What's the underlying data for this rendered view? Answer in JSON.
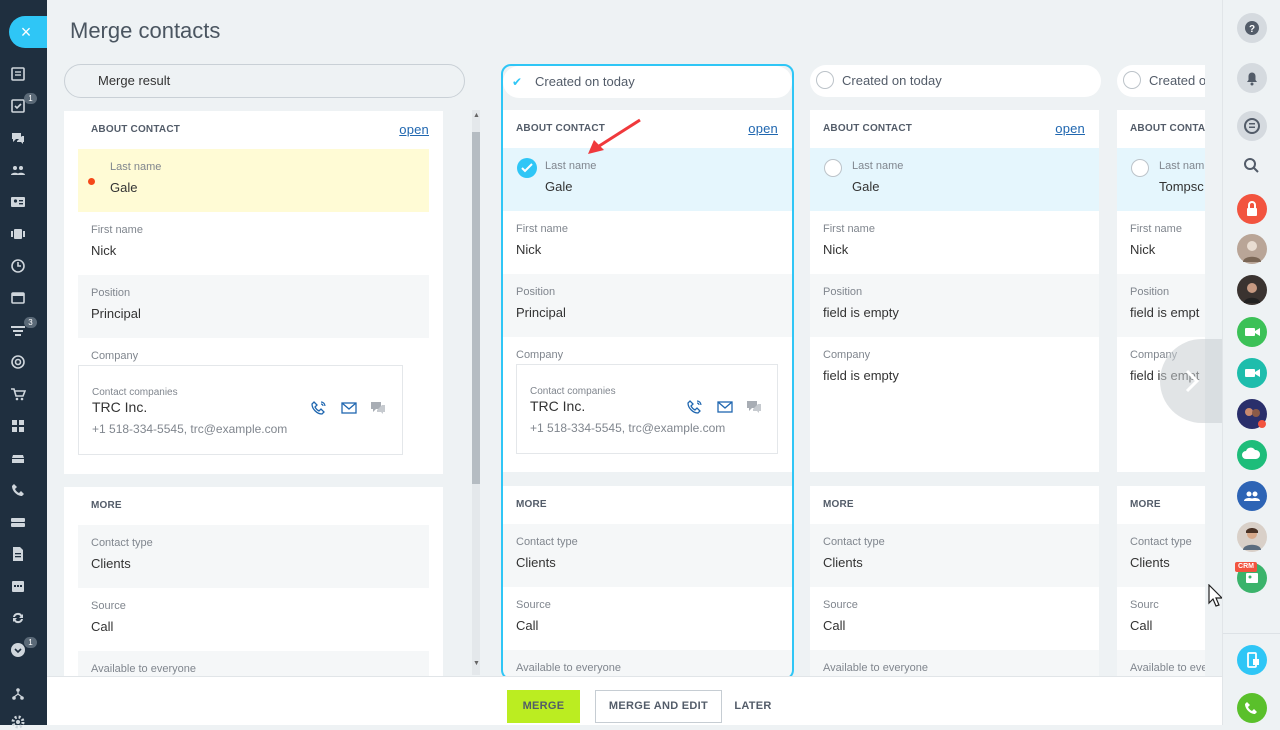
{
  "page": {
    "title": "Merge contacts",
    "close_glyph": "×"
  },
  "left_sidebar": {
    "icons": [
      "feed-icon",
      "tasks-icon",
      "chat-icon",
      "groups-icon",
      "contacts-card-icon",
      "drive-icon",
      "clock-icon",
      "calendar-window-icon",
      "funnel-icon",
      "target-icon",
      "cart-icon",
      "apps-icon",
      "stack-icon",
      "phone-icon",
      "storage-icon",
      "document-icon",
      "calendar-icon",
      "sync-icon",
      "more-icon",
      "sitemap-icon",
      "gear-icon"
    ],
    "badges": {
      "tasks": "1",
      "funnel": "3",
      "more": "1"
    }
  },
  "merge_result": {
    "label": "Merge result",
    "about_header": "ABOUT CONTACT",
    "open_link": "open",
    "fields": [
      {
        "label": "Last name",
        "value": "Gale"
      },
      {
        "label": "First name",
        "value": "Nick"
      },
      {
        "label": "Position",
        "value": "Principal"
      },
      {
        "label": "Company",
        "value": ""
      }
    ],
    "company": {
      "label": "Contact companies",
      "name": "TRC Inc.",
      "meta": "+1 518-334-5545, trc@example.com"
    },
    "more_header": "MORE",
    "more_fields": [
      {
        "label": "Contact type",
        "value": "Clients"
      },
      {
        "label": "Source",
        "value": "Call"
      },
      {
        "label": "Available to everyone",
        "value": ""
      }
    ]
  },
  "columns": [
    {
      "header": "Created on today",
      "selected": true,
      "about_header": "ABOUT CONTACT",
      "open_link": "open",
      "fields": [
        {
          "label": "Last name",
          "value": "Gale"
        },
        {
          "label": "First name",
          "value": "Nick"
        },
        {
          "label": "Position",
          "value": "Principal"
        },
        {
          "label": "Company",
          "value": ""
        }
      ],
      "company": {
        "label": "Contact companies",
        "name": "TRC Inc.",
        "meta": "+1 518-334-5545, trc@example.com"
      },
      "more_header": "MORE",
      "more_fields": [
        {
          "label": "Contact type",
          "value": "Clients"
        },
        {
          "label": "Source",
          "value": "Call"
        },
        {
          "label": "Available to everyone",
          "value": ""
        }
      ]
    },
    {
      "header": "Created on today",
      "selected": false,
      "about_header": "ABOUT CONTACT",
      "open_link": "open",
      "fields": [
        {
          "label": "Last name",
          "value": "Gale"
        },
        {
          "label": "First name",
          "value": "Nick"
        },
        {
          "label": "Position",
          "value": "field is empty"
        },
        {
          "label": "Company",
          "value": "field is empty"
        }
      ],
      "more_header": "MORE",
      "more_fields": [
        {
          "label": "Contact type",
          "value": "Clients"
        },
        {
          "label": "Source",
          "value": "Call"
        },
        {
          "label": "Available to everyone",
          "value": ""
        }
      ]
    },
    {
      "header": "Created o",
      "selected": false,
      "about_header": "ABOUT CONTAC",
      "fields": [
        {
          "label": "Last nam",
          "value": "Tompsc"
        },
        {
          "label": "First name",
          "value": "Nick"
        },
        {
          "label": "Position",
          "value": "field is empt"
        },
        {
          "label": "Company",
          "value": "field is empt"
        }
      ],
      "more_header": "MORE",
      "more_fields": [
        {
          "label": "Contact type",
          "value": "Clients"
        },
        {
          "label": "Sourc",
          "value": "Call"
        },
        {
          "label": "Available to eve",
          "value": ""
        }
      ]
    }
  ],
  "footer": {
    "merge": "MERGE",
    "merge_and_edit": "MERGE AND EDIT",
    "later": "LATER"
  },
  "right_sidebar": {
    "icons": [
      "help-icon",
      "bell-icon",
      "messages-icon",
      "search-icon",
      "lock-icon",
      "avatar-1",
      "avatar-2",
      "video-call-icon",
      "video-call-icon-2",
      "avatar-3",
      "cloud-icon",
      "group-chat-icon",
      "avatar-4",
      "crm-badge-icon",
      "mobile-icon",
      "phone-call-icon"
    ],
    "crm_label": "CRM"
  },
  "colors": {
    "accent": "#2fc6f6",
    "merge_button": "#bbed21",
    "sidebar": "#1f2f3f",
    "highlight_yellow": "#fffbd5",
    "highlight_blue": "#e5f6fd"
  }
}
